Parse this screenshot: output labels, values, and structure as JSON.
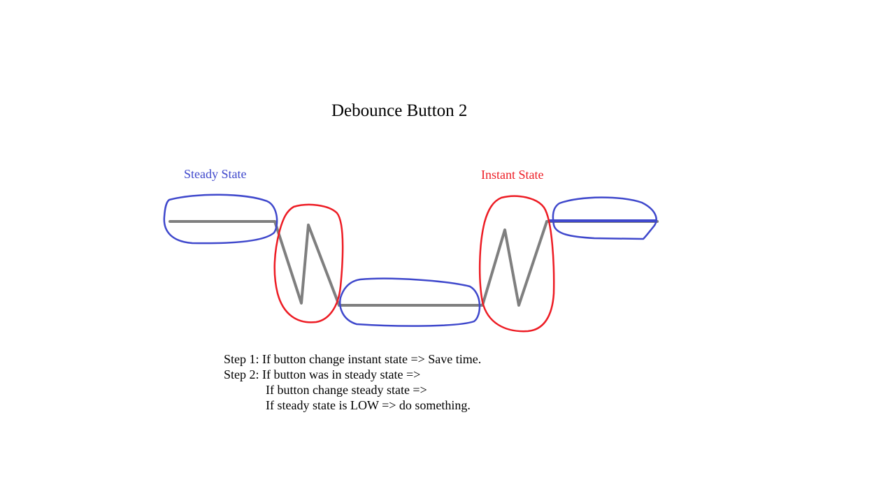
{
  "diagram": {
    "title": "Debounce Button 2",
    "labels": {
      "steady": "Steady State",
      "instant": "Instant State"
    },
    "steps": [
      "Step 1: If button change instant state => Save time.",
      "Step 2: If button was in steady state =>",
      "If button change steady state =>",
      "If steady state is LOW => do something."
    ]
  },
  "colors": {
    "steady": "#3f48cc",
    "instant": "#ed1c24",
    "signal": "#7f7f7f",
    "text": "#000000"
  }
}
